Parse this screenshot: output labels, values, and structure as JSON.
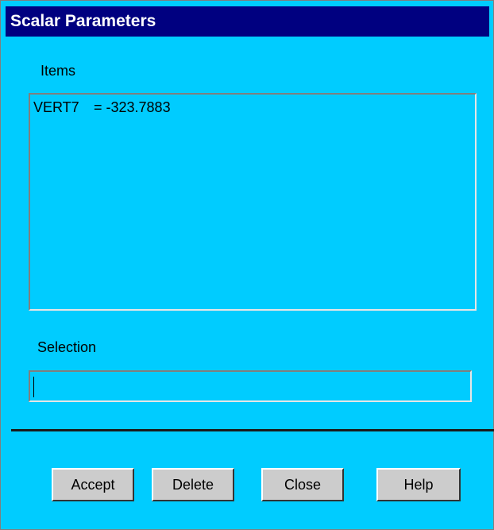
{
  "window": {
    "title": "Scalar Parameters"
  },
  "items": {
    "label": "Items",
    "list": [
      {
        "name": "VERT7",
        "value": "= -323.7883"
      }
    ]
  },
  "selection": {
    "label": "Selection",
    "value": ""
  },
  "buttons": {
    "accept": "Accept",
    "delete": "Delete",
    "close": "Close",
    "help": "Help"
  },
  "colors": {
    "background": "#00ccff",
    "title_bar": "#000080",
    "button_face": "#cccccc"
  }
}
